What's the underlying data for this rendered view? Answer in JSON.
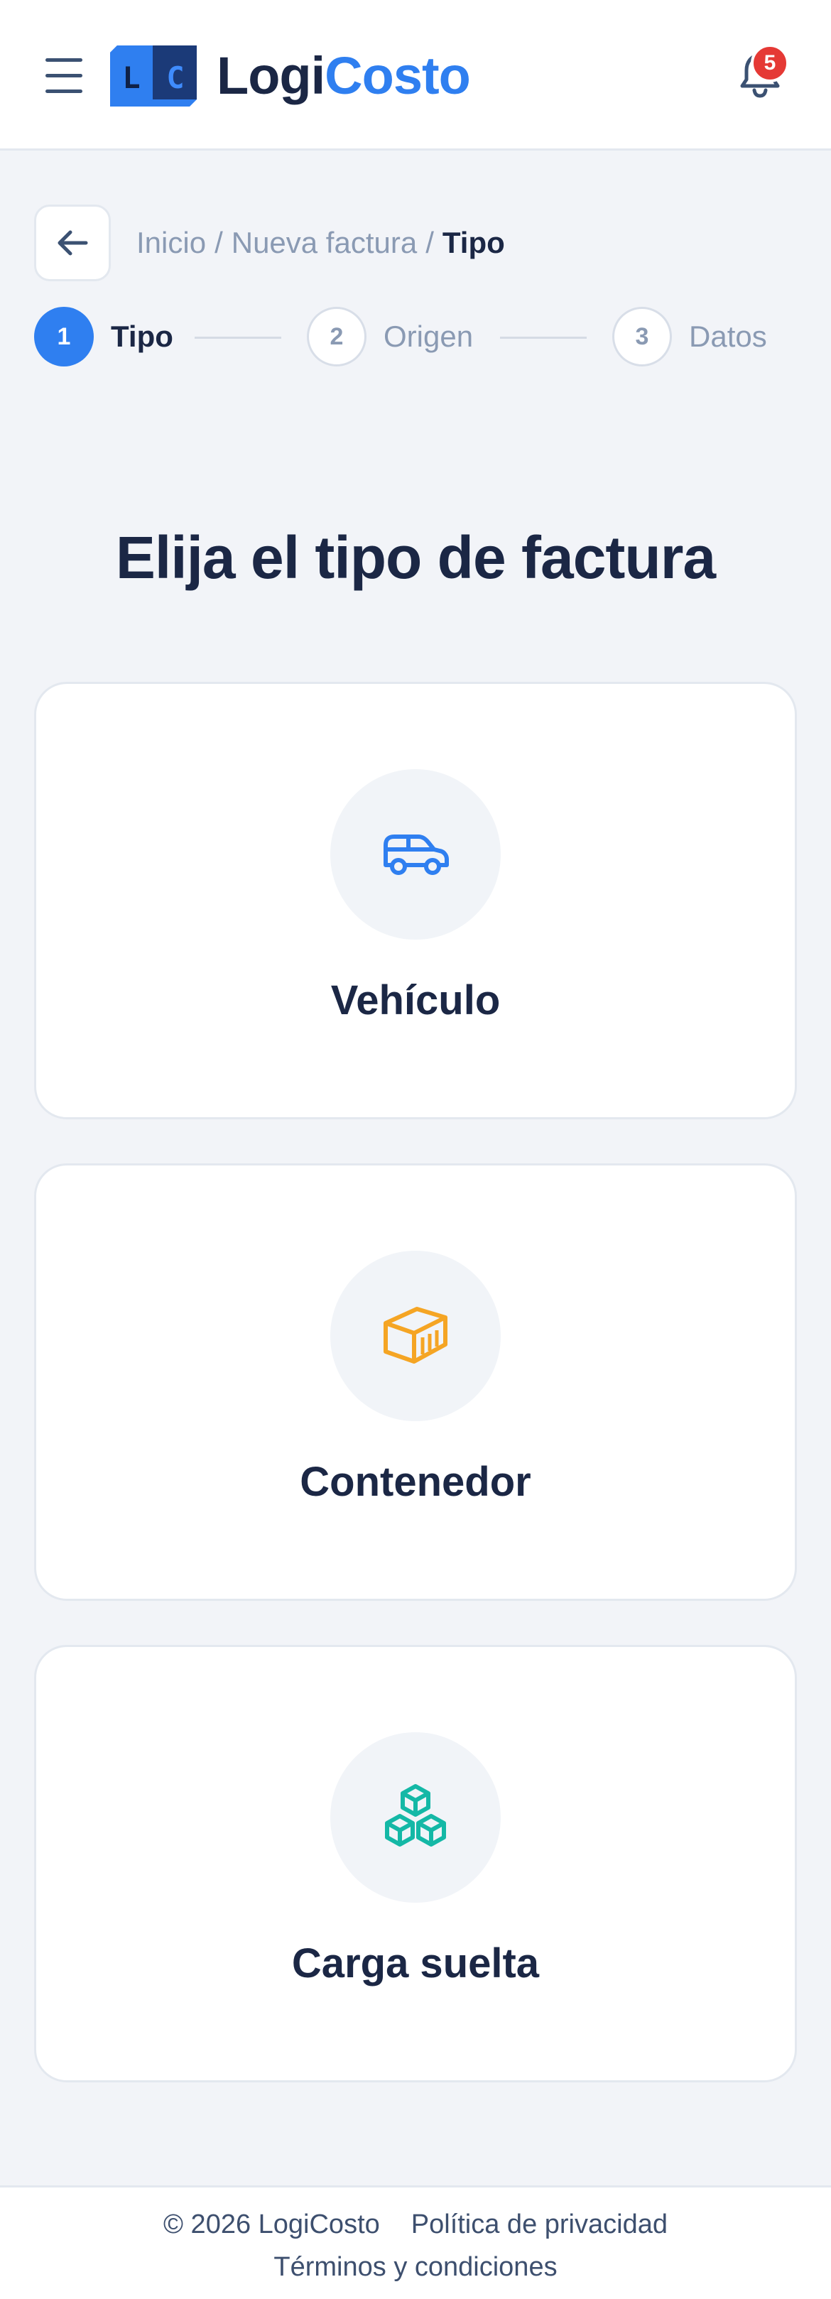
{
  "header": {
    "logo_letters": "L C",
    "brand_part1": "Logi",
    "brand_part2": "Costo",
    "notification_count": "5",
    "icons": {
      "menu": "hamburger-menu-icon",
      "bell": "bell-icon"
    }
  },
  "breadcrumb": {
    "items": [
      "Inicio",
      "Nueva factura"
    ],
    "separator": "/",
    "current": "Tipo",
    "back_icon": "arrow-left-icon"
  },
  "stepper": {
    "steps": [
      {
        "number": "1",
        "label": "Tipo",
        "state": "active"
      },
      {
        "number": "2",
        "label": "Origen",
        "state": "pending"
      },
      {
        "number": "3",
        "label": "Datos",
        "state": "pending"
      }
    ]
  },
  "main": {
    "title": "Elija el tipo de factura",
    "options": [
      {
        "label": "Vehículo",
        "icon": "car-icon",
        "color": "#2f7ff0"
      },
      {
        "label": "Contenedor",
        "icon": "container-icon",
        "color": "#f5a524"
      },
      {
        "label": "Carga suelta",
        "icon": "boxes-icon",
        "color": "#14b8a6"
      }
    ]
  },
  "footer": {
    "copyright": "© 2026 LogiCosto",
    "privacy": "Política de privacidad",
    "terms": "Términos y condiciones"
  },
  "colors": {
    "accent": "#2f7ff0",
    "text": "#1b2745",
    "muted": "#8a9ab3",
    "background": "#f2f4f8",
    "badge": "#e53935"
  }
}
